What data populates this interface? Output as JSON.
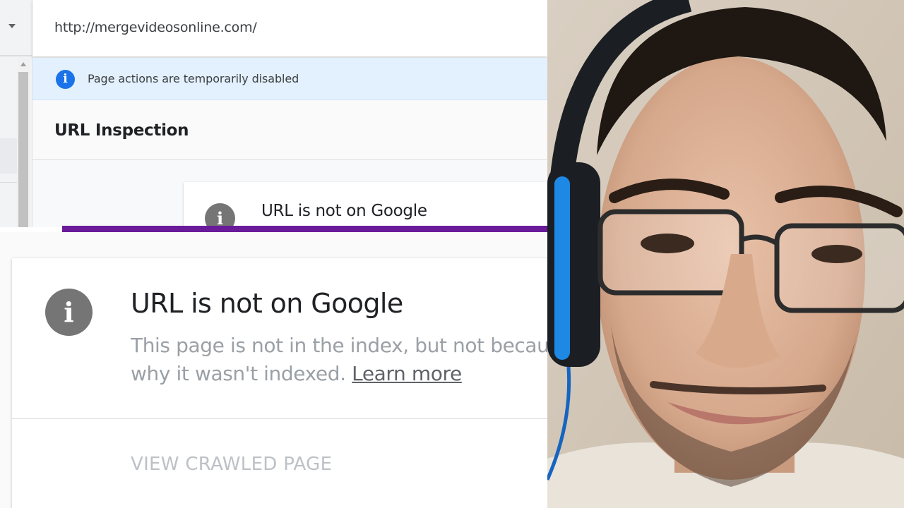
{
  "browser": {
    "url": "http://mergevideosonline.com/"
  },
  "banner": {
    "icon": "info-icon",
    "text": "Page actions are temporarily disabled"
  },
  "inspection": {
    "title": "URL Inspection",
    "status_title": "URL is not on Google"
  },
  "zoom": {
    "status_title": "URL is not on Google",
    "desc_line1": "This page is not in the index, but not because",
    "desc_line2": "why it wasn't indexed.",
    "learn_more": "Learn more",
    "view_crawled_page": "VIEW CRAWLED PAGE"
  },
  "colors": {
    "accent_blue": "#1a73e8",
    "banner_bg": "#e3f0fd",
    "purple_divider": "#6a1b9a",
    "info_gray": "#757575"
  }
}
